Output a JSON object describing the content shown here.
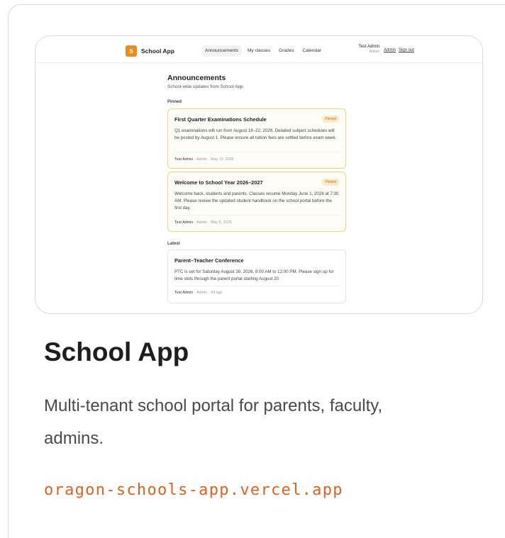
{
  "preview": {
    "app": {
      "logo_letter": "S",
      "name": "School App"
    },
    "nav": [
      "Announcements",
      "My classes",
      "Grades",
      "Calendar"
    ],
    "active_nav": "Announcements",
    "user": {
      "name": "Test Admin",
      "role": "Admin"
    },
    "links": {
      "admin": "Admin",
      "signout": "Sign out"
    },
    "page": {
      "title": "Announcements",
      "subtitle": "School-wide updates from School App."
    },
    "sections": {
      "pinned": "Pinned",
      "latest": "Latest"
    },
    "pinned": [
      {
        "title": "First Quarter Examinations Schedule",
        "badge": "Pinned",
        "body": "Q1 examinations will run from August 18–22, 2026. Detailed subject schedules will be posted by August 1. Please ensure all tuition fees are settled before exam week.",
        "author": "Test Admin",
        "role": "Admin",
        "date": "May 13, 2026"
      },
      {
        "title": "Welcome to School Year 2026–2027",
        "badge": "Pinned",
        "body": "Welcome back, students and parents. Classes resume Monday June 1, 2026 at 7:30 AM. Please review the updated student handbook on the school portal before the first day.",
        "author": "Test Admin",
        "role": "Admin",
        "date": "May 6, 2026"
      }
    ],
    "latest": [
      {
        "title": "Parent–Teacher Conference",
        "body": "PTC is set for Saturday August 30, 2026, 8:00 AM to 12:00 PM. Please sign up for time slots through the parent portal starting August 20.",
        "author": "Test Admin",
        "role": "Admin",
        "date": "3d ago"
      }
    ]
  },
  "card": {
    "title": "School App",
    "description": "Multi-tenant school portal for parents, faculty, admins.",
    "url": "oragon-schools-app.vercel.app"
  },
  "colors": {
    "brand": "#f08a1f",
    "url": "#e0611f",
    "pinned_border": "#f3d27a",
    "badge_bg": "#fdeacb"
  }
}
